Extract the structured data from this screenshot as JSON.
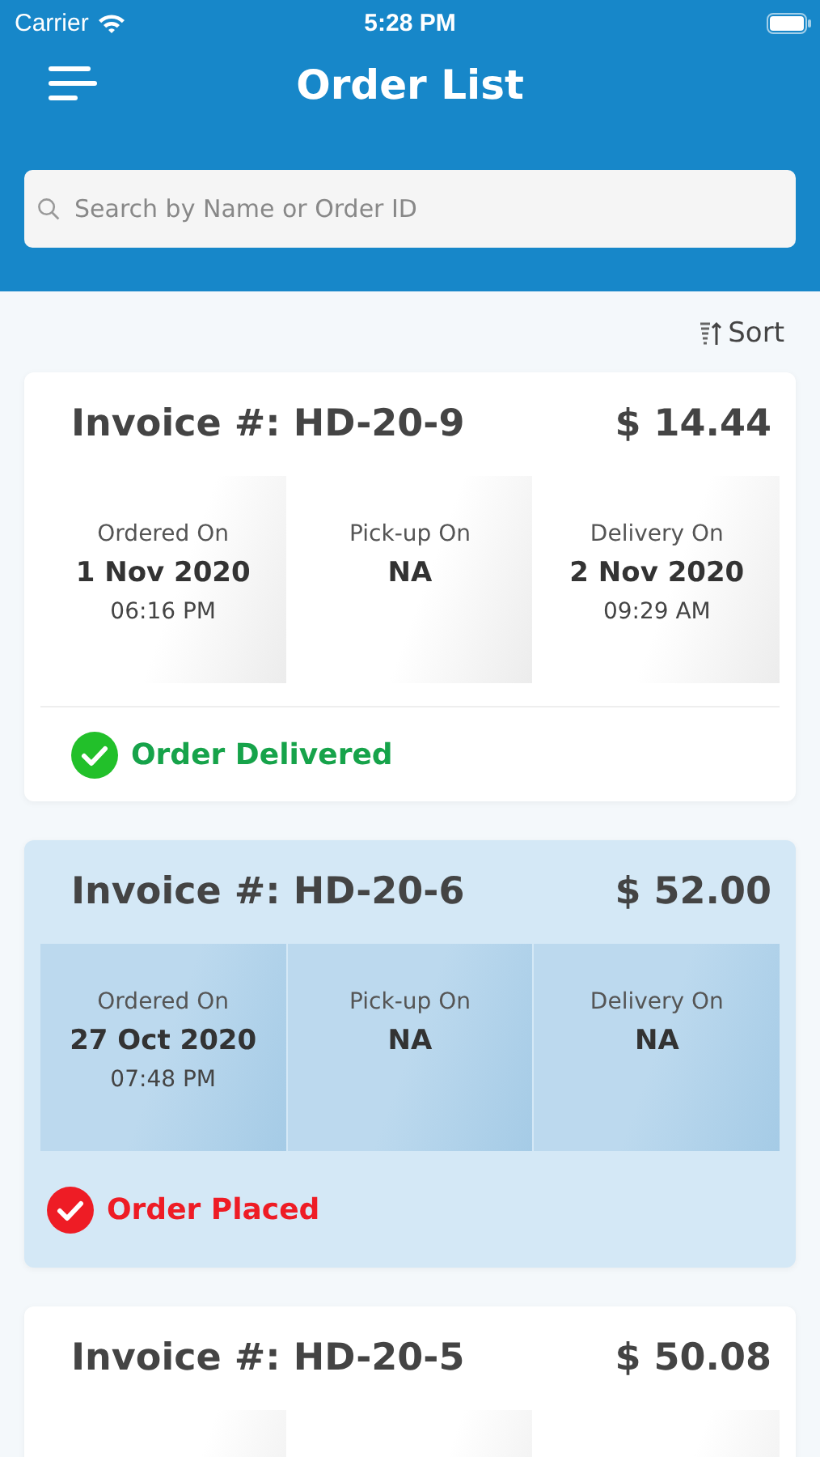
{
  "status_bar": {
    "carrier": "Carrier",
    "time": "5:28 PM"
  },
  "header": {
    "title": "Order List"
  },
  "search": {
    "placeholder": "Search by Name or Order ID"
  },
  "sort": {
    "label": "Sort"
  },
  "orders": [
    {
      "invoice": "Invoice #: HD-20-9",
      "amount": "$ 14.44",
      "selected": false,
      "cells": [
        {
          "label": "Ordered On",
          "date": "1 Nov 2020",
          "time": "06:16 PM"
        },
        {
          "label": "Pick-up On",
          "date": "NA"
        },
        {
          "label": "Delivery On",
          "date": "2 Nov 2020",
          "time": "09:29 AM"
        }
      ],
      "status": {
        "text": "Order Delivered",
        "color": "#22c02a"
      }
    },
    {
      "invoice": "Invoice #: HD-20-6",
      "amount": "$ 52.00",
      "selected": true,
      "cells": [
        {
          "label": "Ordered On",
          "date": "27 Oct 2020",
          "time": "07:48 PM"
        },
        {
          "label": "Pick-up On",
          "date": "NA"
        },
        {
          "label": "Delivery On",
          "date": "NA"
        }
      ],
      "status": {
        "text": "Order Placed",
        "color": "#ee1c25"
      }
    },
    {
      "invoice": "Invoice #: HD-20-5",
      "amount": "$ 50.08",
      "selected": false
    }
  ]
}
